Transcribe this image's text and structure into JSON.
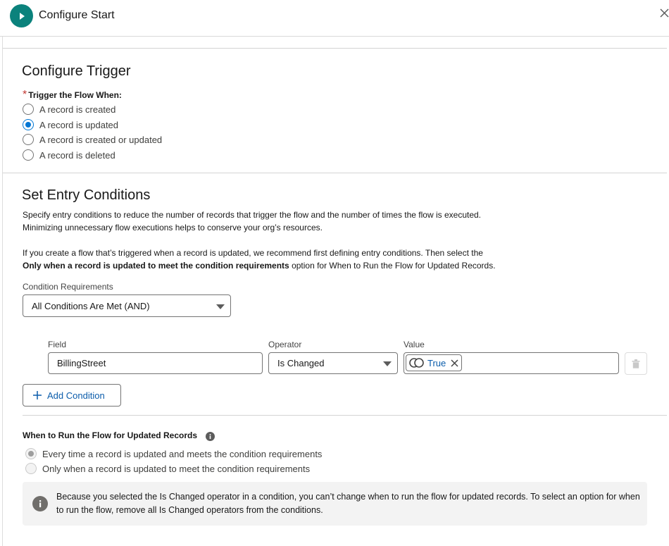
{
  "header": {
    "title": "Configure Start"
  },
  "trigger": {
    "heading": "Configure Trigger",
    "label": "Trigger the Flow When:",
    "options": [
      {
        "label": "A record is created",
        "checked": false
      },
      {
        "label": "A record is updated",
        "checked": true
      },
      {
        "label": "A record is created or updated",
        "checked": false
      },
      {
        "label": "A record is deleted",
        "checked": false
      }
    ]
  },
  "entry": {
    "heading": "Set Entry Conditions",
    "desc_line1": "Specify entry conditions to reduce the number of records that trigger the flow and the number of times the flow is executed.",
    "desc_line2": "Minimizing unnecessary flow executions helps to conserve your org’s resources.",
    "recommend_line1": "If you create a flow that’s triggered when a record is updated, we recommend first defining entry conditions. Then select the",
    "recommend_bold": "Only when a record is updated to meet the condition requirements",
    "recommend_tail": " option for When to Run the Flow for Updated Records.",
    "condition_req_label": "Condition Requirements",
    "condition_req_value": "All Conditions Are Met (AND)"
  },
  "condition_row": {
    "field_label": "Field",
    "field_value": "BillingStreet",
    "operator_label": "Operator",
    "operator_value": "Is Changed",
    "value_label": "Value",
    "value_pill": "True"
  },
  "add_condition_label": "Add Condition",
  "when_run": {
    "label": "When to Run the Flow for Updated Records",
    "options": [
      {
        "label": "Every time a record is updated and meets the condition requirements",
        "checked": true
      },
      {
        "label": "Only when a record is updated to meet the condition requirements",
        "checked": false
      }
    ]
  },
  "info": {
    "text": "Because you selected the Is Changed operator in a condition, you can’t change when to run the flow for updated records. To select an option for when to run the flow, remove all Is Changed operators from the conditions."
  },
  "colors": {
    "brand": "#0b827c",
    "accent": "#0176d3",
    "link": "#0b5cab"
  }
}
